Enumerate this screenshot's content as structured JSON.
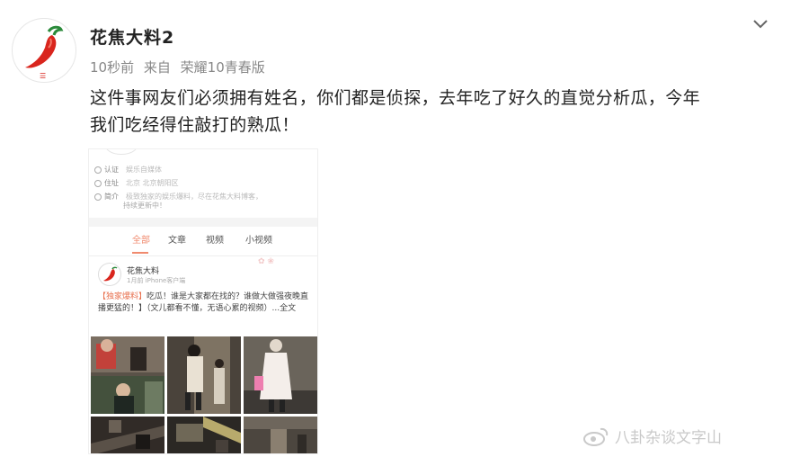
{
  "post": {
    "author": "花焦大料2",
    "time": "10秒前",
    "source_prefix": "来自",
    "source": "荣耀10青春版",
    "text_line1": "这件事网友们必须拥有姓名，你们都是侦探，去年吃了好久的直觉分析瓜，今年",
    "text_line2": "我们吃经得住敲打的熟瓜！"
  },
  "embed": {
    "info": [
      {
        "label": "认证",
        "value": "娱乐自媒体"
      },
      {
        "label": "住址",
        "value": "北京 北京朝阳区"
      },
      {
        "label": "简介",
        "value": "极致独家的娱乐爆料，尽在花焦大料博客，"
      }
    ],
    "intro_line2": "持续更新中！",
    "tabs": [
      "全部",
      "文章",
      "视频",
      "小视频"
    ],
    "active_tab": "全部",
    "mini_author": "花焦大料",
    "mini_meta": "1月前 iPhone客户端",
    "mini_text_highlight": "【独家爆料】",
    "mini_text": "吃瓜！谁是大家都在找的？谁做大做强夜晚直播更猛的！】（文儿都看不懂，无语心累的视频）...全文"
  },
  "watermark": "八卦杂谈文字山",
  "colors": {
    "accent": "#f08a6e",
    "chili": "#d9251d",
    "text": "#222222",
    "meta": "#888888"
  }
}
